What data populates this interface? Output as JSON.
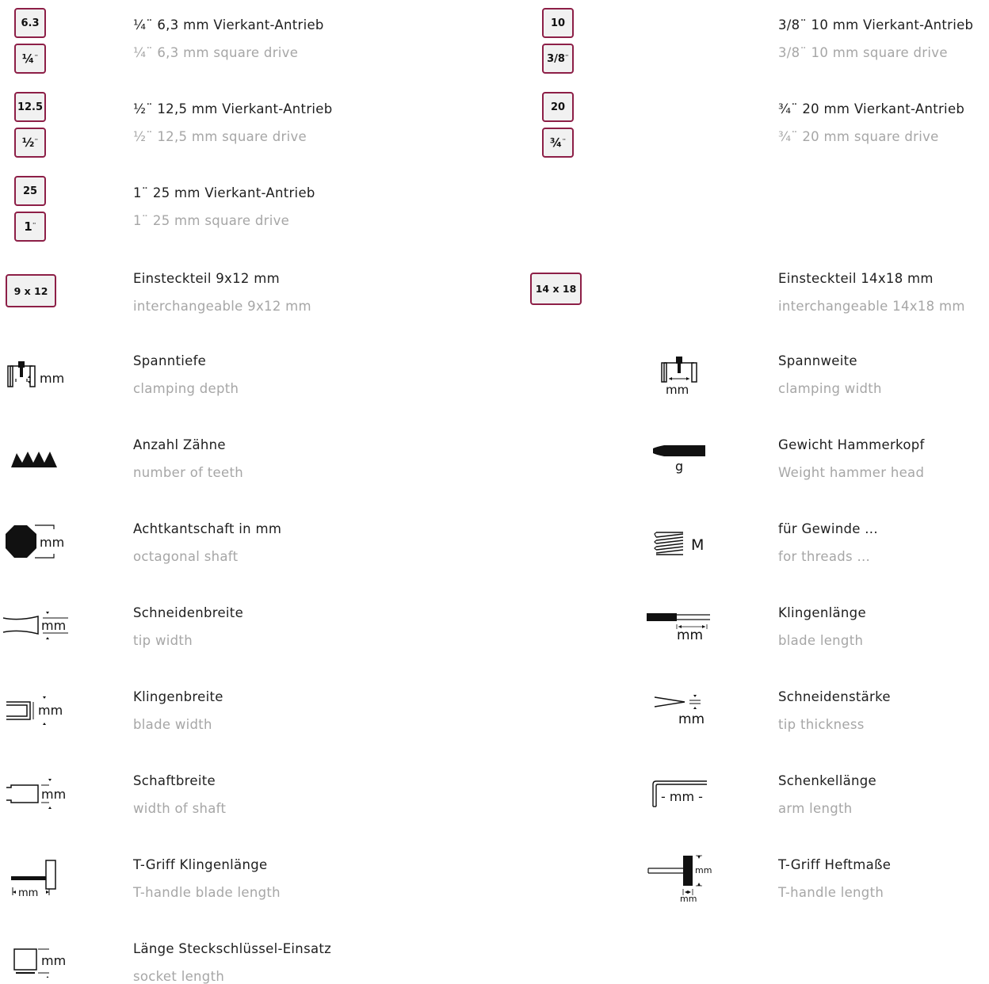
{
  "drive_left": [
    {
      "top_label": "6.3",
      "bottom_label": "¼",
      "de": "¼¨  6,3 mm Vierkant-Antrieb",
      "en": "¼¨  6,3 mm square drive"
    },
    {
      "top_label": "12.5",
      "bottom_label": "½",
      "de": "½¨  12,5 mm Vierkant-Antrieb",
      "en": "½¨  12,5 mm square drive"
    },
    {
      "top_label": "25",
      "bottom_label": "1",
      "de": "1¨  25 mm Vierkant-Antrieb",
      "en": "1¨  25 mm square drive"
    }
  ],
  "drive_right": [
    {
      "top_label": "10",
      "bottom_label": "3/8",
      "de": "3/8¨  10 mm Vierkant-Antrieb",
      "en": "3/8¨  10 mm square drive"
    },
    {
      "top_label": "20",
      "bottom_label": "¾",
      "de": "¾¨  20 mm Vierkant-Antrieb",
      "en": "¾¨  20 mm square drive"
    }
  ],
  "insert_left": {
    "label": "9 x 12",
    "de": "Einsteckteil 9x12 mm",
    "en": "interchangeable 9x12 mm"
  },
  "insert_right": {
    "label": "14 x 18",
    "de": "Einsteckteil 14x18 mm",
    "en": "interchangeable 14x18 mm"
  },
  "symbols_left": [
    {
      "icon": "clamping-depth-icon",
      "icon_text": "mm",
      "de": "Spanntiefe",
      "en": "clamping depth"
    },
    {
      "icon": "teeth-icon",
      "de": "Anzahl Zähne",
      "en": "number of teeth"
    },
    {
      "icon": "octagon-shaft-icon",
      "icon_text": "mm",
      "de": "Achtkantschaft in mm",
      "en": "octagonal shaft"
    },
    {
      "icon": "tip-width-icon",
      "icon_text": "mm",
      "de": "Schneidenbreite",
      "en": "tip width"
    },
    {
      "icon": "blade-width-icon",
      "icon_text": "mm",
      "de": "Klingenbreite",
      "en": "blade width"
    },
    {
      "icon": "shaft-width-icon",
      "icon_text": "mm",
      "de": "Schaftbreite",
      "en": "width of shaft"
    },
    {
      "icon": "t-handle-blade-icon",
      "icon_text": "mm",
      "de": "T-Griff Klingenlänge",
      "en": "T-handle blade length"
    },
    {
      "icon": "socket-length-icon",
      "icon_text": "mm",
      "de": "Länge Steckschlüssel-Einsatz",
      "en": "socket length"
    }
  ],
  "symbols_right": [
    {
      "icon": "clamping-width-icon",
      "icon_text": "mm",
      "de": "Spannweite",
      "en": "clamping width"
    },
    {
      "icon": "hammer-head-icon",
      "icon_text": "g",
      "de": "Gewicht Hammerkopf",
      "en": "Weight hammer head"
    },
    {
      "icon": "thread-icon",
      "icon_text": "M",
      "de": "für Gewinde ...",
      "en": "for threads ..."
    },
    {
      "icon": "blade-length-icon",
      "icon_text": "mm",
      "de": "Klingenlänge",
      "en": "blade length"
    },
    {
      "icon": "tip-thickness-icon",
      "icon_text": "mm",
      "de": "Schneidenstärke",
      "en": "tip thickness"
    },
    {
      "icon": "arm-length-icon",
      "icon_text": "- mm -",
      "de": "Schenkellänge",
      "en": "arm length"
    },
    {
      "icon": "t-handle-length-icon",
      "icon_text": "mm",
      "de": "T-Griff Heftmaße",
      "en": "T-handle length"
    }
  ],
  "colors": {
    "accent": "#8d1f47",
    "box_fill": "#f1f1f1",
    "text_de": "#1e1e1e",
    "text_en": "#a6a6a6"
  }
}
